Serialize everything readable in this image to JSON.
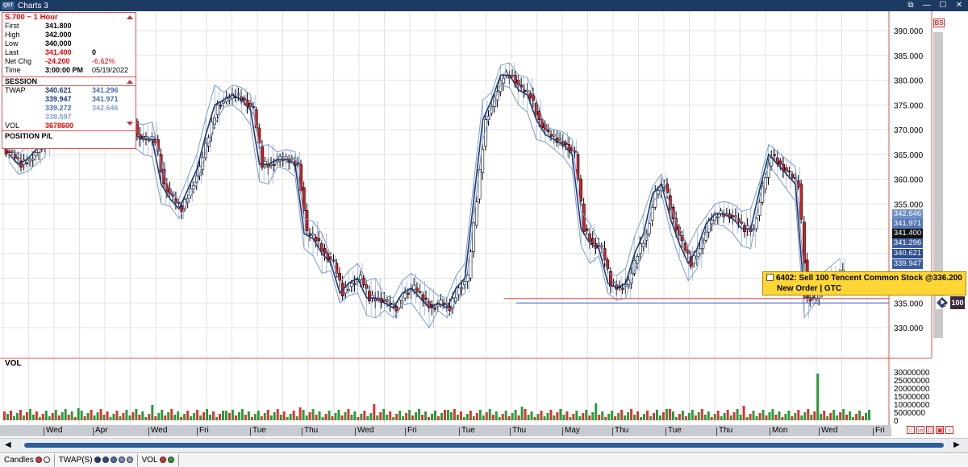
{
  "window": {
    "title": "Charts 3",
    "logo": "QST"
  },
  "info_panel": {
    "header": "S.700 ~ 1 Hour",
    "rows": [
      {
        "label": "First",
        "v1": "341.800",
        "v2": ""
      },
      {
        "label": "High",
        "v1": "342.000",
        "v2": ""
      },
      {
        "label": "Low",
        "v1": "340.000",
        "v2": ""
      },
      {
        "label": "Last",
        "v1": "341.400",
        "v2": "0"
      },
      {
        "label": "Net Chg",
        "v1": "-24.200",
        "v2": "-6.62%"
      },
      {
        "label": "Time",
        "v1": "3:00:00 PM",
        "v2": "05/19/2022"
      }
    ],
    "session_label": "SESSION",
    "twap_label": "TWAP",
    "twap_values": [
      [
        "340.621",
        "341.296"
      ],
      [
        "339.947",
        "341.971"
      ],
      [
        "339.272",
        "342.646"
      ],
      [
        "338.597",
        ""
      ]
    ],
    "vol_label": "VOL",
    "vol_value": "3678600",
    "position_label": "POSITION P/L"
  },
  "order_tooltip": {
    "line1": "6402: Sell 100  Tencent Common Stock @336.200",
    "line2": "New Order | GTC"
  },
  "price_axis": {
    "ticks": [
      "390.000",
      "385.000",
      "380.000",
      "375.000",
      "370.000",
      "365.000",
      "360.000",
      "355.000",
      "335.000",
      "330.000"
    ],
    "tags": [
      {
        "label": "342.646",
        "color": "#6d8fc4"
      },
      {
        "label": "341.971",
        "color": "#5478b3"
      },
      {
        "label": "341.400",
        "color": "#111111"
      },
      {
        "label": "341.296",
        "color": "#3c5c9c"
      },
      {
        "label": "340.621",
        "color": "#2a4a8a"
      },
      {
        "label": "339.947",
        "color": "#3c5c9c"
      }
    ],
    "bs_tag": "BS",
    "order_qty": "100"
  },
  "volume_axis": {
    "label": "VOL",
    "ticks": [
      "30000000",
      "25000000",
      "20000000",
      "15000000",
      "10000000",
      "5000000",
      "0"
    ]
  },
  "date_axis": {
    "labels": [
      "Wed",
      "Apr",
      "Wed",
      "Fri",
      "Tue",
      "Thu",
      "Wed",
      "Fri",
      "Tue",
      "Thu",
      "May",
      "Thu",
      "Tue",
      "Thu",
      "Mon",
      "Wed",
      "Fri"
    ]
  },
  "legend": {
    "items": [
      {
        "label": "Candles",
        "dots": [
          "#e03030",
          "#ffffff"
        ]
      },
      {
        "label": "TWAP(S)",
        "dots": [
          "#1a3b78",
          "#2a4a8a",
          "#4a6fb0",
          "#6d8fc4",
          "#8aa0c8"
        ]
      },
      {
        "label": "VOL",
        "dots": [
          "#e03030",
          "#2a9a3a"
        ]
      }
    ]
  },
  "colors": {
    "up_candle": "#ffffff",
    "down_candle": "#d81e1e",
    "twap_band": "#7d9bd1",
    "title_bar": "#1d3a63",
    "order_line": "#e04040",
    "vol_up": "#2a9a3a",
    "vol_down": "#e03030"
  },
  "chart_data": {
    "type": "candlestick",
    "price_range": [
      326,
      393
    ],
    "close_series_approx": [
      365,
      363,
      364,
      366,
      368,
      387,
      385,
      383,
      383,
      383,
      381,
      378,
      377,
      377,
      369,
      368,
      368,
      359,
      356,
      354,
      358,
      362,
      369,
      375,
      376,
      377,
      376,
      374,
      363,
      363,
      364,
      364,
      363,
      349,
      348,
      345,
      343,
      337,
      339,
      340,
      336,
      336,
      335,
      334,
      337,
      338,
      336,
      334,
      335,
      334,
      338,
      340,
      356,
      372,
      376,
      381,
      381,
      378,
      377,
      372,
      369,
      368,
      367,
      365,
      350,
      347,
      346,
      339,
      338,
      339,
      345,
      349,
      357,
      359,
      352,
      347,
      343,
      346,
      351,
      353,
      353,
      352,
      350,
      350,
      358,
      365,
      363,
      361,
      359,
      336,
      336,
      339,
      340,
      341
    ]
  }
}
